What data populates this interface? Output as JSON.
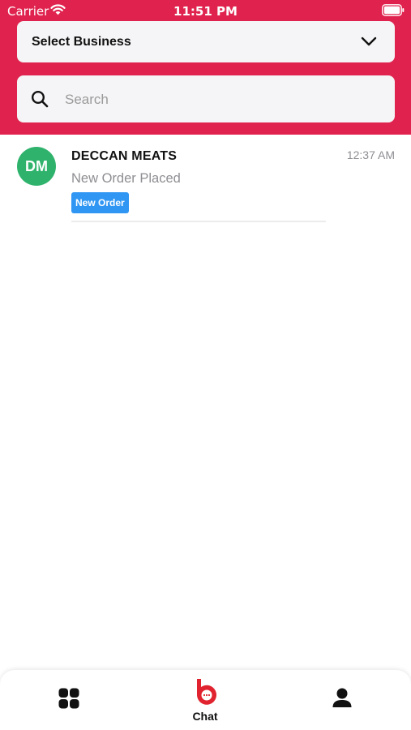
{
  "status_bar": {
    "carrier": "Carrier",
    "time": "11:51 PM"
  },
  "colors": {
    "header_bg": "#e0234e",
    "avatar_bg": "#2fb36c",
    "badge_bg": "#2f96f3",
    "chat_logo": "#e0232e"
  },
  "business_select": {
    "label": "Select Business",
    "icon": "chevron-down-icon"
  },
  "search": {
    "placeholder": "Search",
    "value": "",
    "icon": "search-icon"
  },
  "chats": [
    {
      "avatar_initials": "DM",
      "name": "DECCAN MEATS",
      "time": "12:37 AM",
      "preview": "New Order Placed",
      "badge": "New Order"
    }
  ],
  "tab_bar": {
    "tabs": [
      {
        "icon": "grid-icon",
        "label": ""
      },
      {
        "icon": "chat-logo-icon",
        "label": "Chat",
        "active": true
      },
      {
        "icon": "person-icon",
        "label": ""
      }
    ]
  }
}
